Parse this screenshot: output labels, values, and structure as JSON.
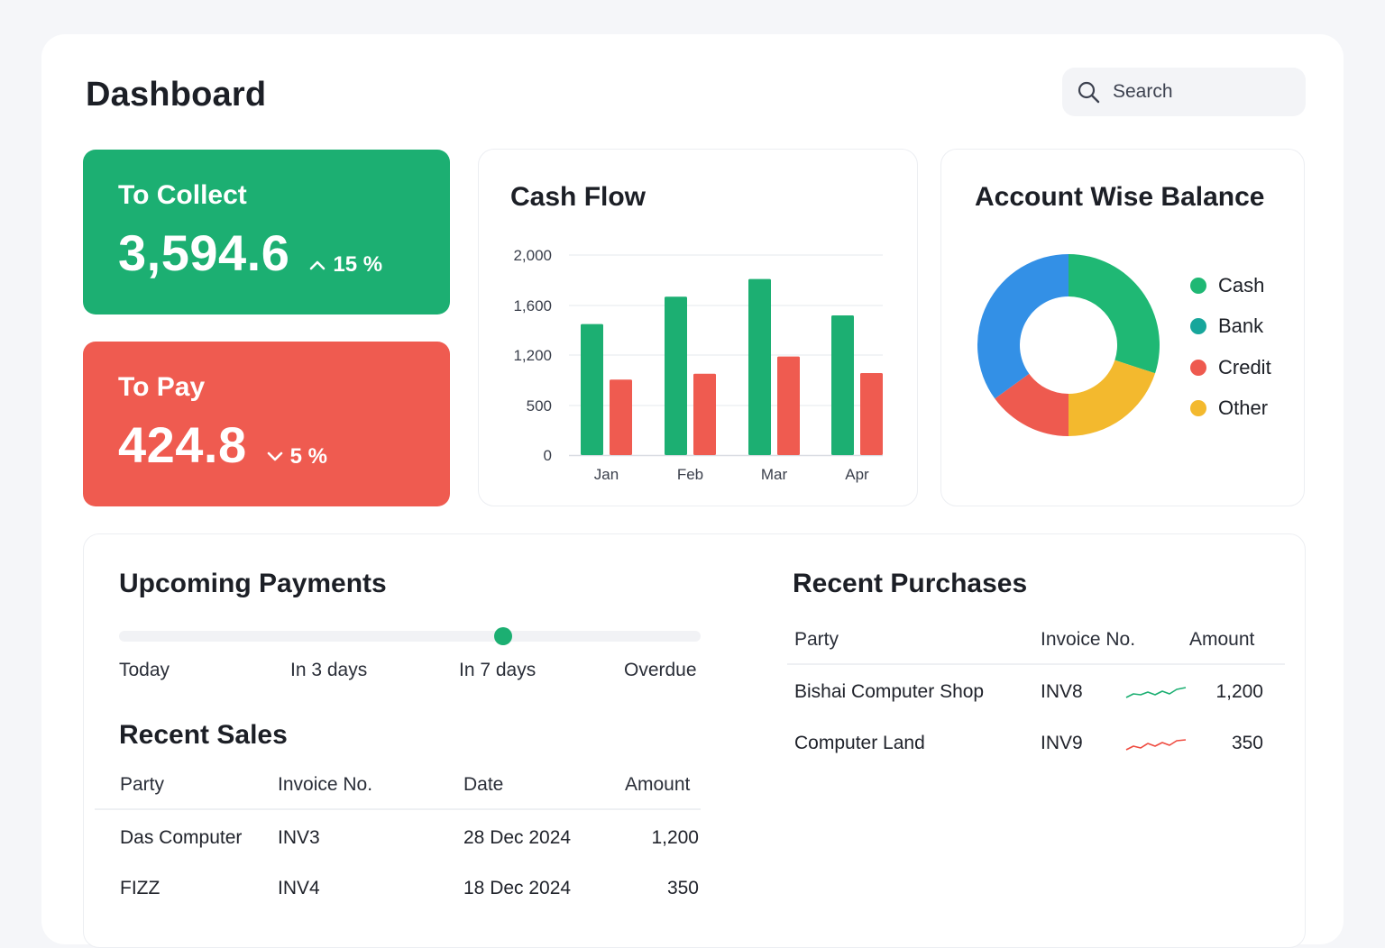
{
  "header": {
    "title": "Dashboard"
  },
  "search": {
    "placeholder": "Search",
    "icon": "search-icon"
  },
  "to_collect": {
    "label": "To Collect",
    "value": "3,594.6",
    "trend": "15 %",
    "direction": "up",
    "color": "#1caf72"
  },
  "to_pay": {
    "label": "To Pay",
    "value": "424.8",
    "trend": "5 %",
    "direction": "down",
    "color": "#ef5b50"
  },
  "cash_flow": {
    "title": "Cash Flow",
    "chart_data": {
      "type": "bar",
      "categories": [
        "Jan",
        "Feb",
        "Mar",
        "Apr"
      ],
      "y_ticks": [
        "0",
        "500",
        "1,200",
        "1,600",
        "2,000"
      ],
      "series": [
        {
          "values": [
            1450,
            1670,
            1810,
            1520
          ],
          "color": "#1caf72"
        },
        {
          "values": [
            860,
            940,
            1180,
            950
          ],
          "color": "#ef5b50"
        }
      ],
      "grid": true
    }
  },
  "account_balance": {
    "title": "Account Wise Balance",
    "chart_data": {
      "type": "pie",
      "labels": [
        "Cash",
        "Bank",
        "Credit",
        "Other"
      ],
      "values": [
        30,
        35,
        15,
        20
      ],
      "colors": [
        "#1fb874",
        "#3390e6",
        "#ee5a4f",
        "#f3b92e"
      ],
      "legend_colors": [
        "#1fb874",
        "#17a69b",
        "#ee5a4f",
        "#f3b92e"
      ],
      "legend": "right"
    }
  },
  "upcoming_payments": {
    "title": "Upcoming Payments",
    "stops": [
      "Today",
      "In 3 days",
      "In 7 days",
      "Overdue"
    ],
    "selected_position": 0.66
  },
  "recent_sales": {
    "title": "Recent Sales",
    "columns": [
      "Party",
      "Invoice No.",
      "Date",
      "Amount"
    ],
    "rows": [
      {
        "party": "Das Computer",
        "invoice": "INV3",
        "date": "28 Dec 2024",
        "amount": "1,200"
      },
      {
        "party": "FIZZ",
        "invoice": "INV4",
        "date": "18 Dec 2024",
        "amount": "350"
      }
    ]
  },
  "recent_purchases": {
    "title": "Recent Purchases",
    "columns": [
      "Party",
      "Invoice No.",
      "Amount"
    ],
    "rows": [
      {
        "party": "Bishai Computer Shop",
        "invoice": "INV8",
        "amount": "1,200",
        "trend_color": "#1caf72"
      },
      {
        "party": "Computer Land",
        "invoice": "INV9",
        "amount": "350",
        "trend_color": "#ef4b40"
      }
    ]
  }
}
